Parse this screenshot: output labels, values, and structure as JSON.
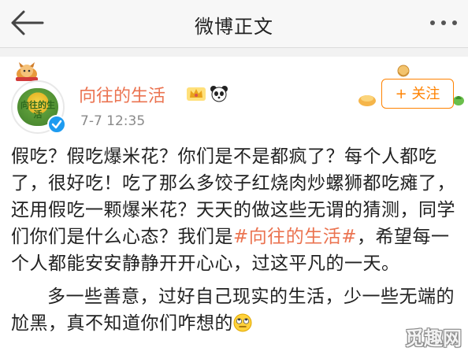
{
  "header": {
    "title": "微博正文"
  },
  "post": {
    "username": "向往的生活",
    "time": "7-7 12:35",
    "follow_label": "+ 关注",
    "avatar_text": "向往的生活",
    "p1_a": "假吃？假吃爆米花？你们是不是都疯了？每个人都吃了，很好吃！吃了那么多饺子红烧肉炒螺狮都吃瘫了，还用假吃一颗爆米花？天天的做这些无谓的猜测，同学们你们是什么心态？我们是",
    "hashtag": "#向往的生活#",
    "p1_b": "，希望每一个人都能安安静静开开心心，过这平凡的一天。",
    "p2": "多一些善意，过好自己现实的生活，少一些无端的尬黑，真不知道你们咋想的",
    "emoji_icon": "rolling-eyes-emoji"
  },
  "watermark": {
    "text": "觅趣网"
  },
  "colors": {
    "accent": "#eb7350",
    "follow": "#ff8200",
    "verify": "#1d9bf0"
  }
}
